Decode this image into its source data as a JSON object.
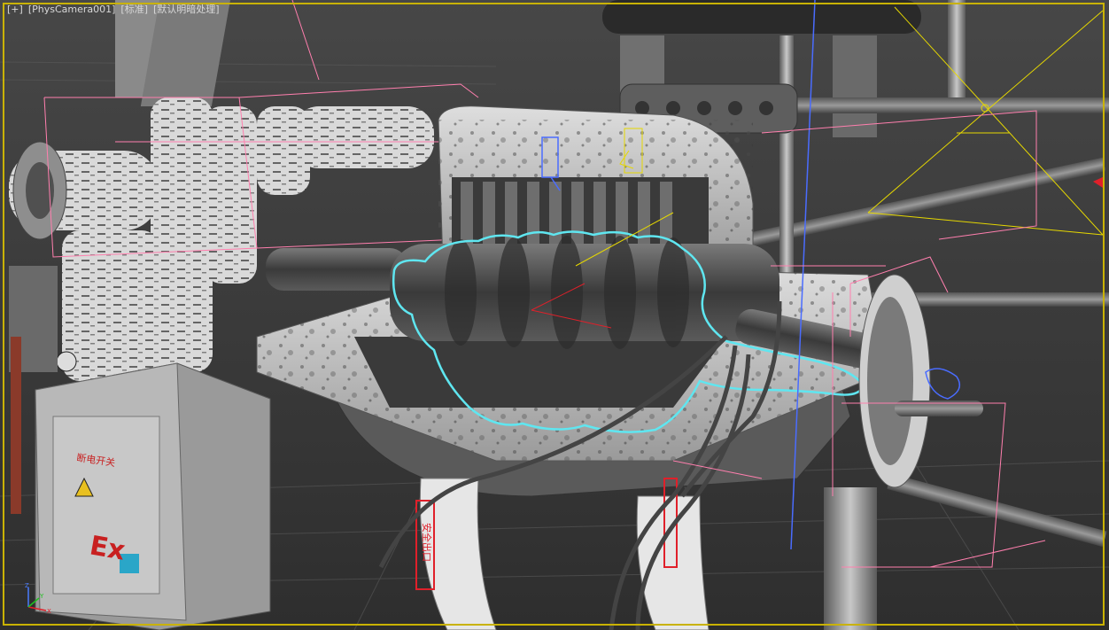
{
  "viewport": {
    "menu_plus": "[+]",
    "camera": "[PhysCamera001]",
    "shading": "[标准]",
    "lighting": "[默认明暗处理]"
  },
  "scene_labels": {
    "panel_sign": "断电开关",
    "panel_ex": "Ex",
    "pedestal_sign": "安全出口"
  },
  "gizmo": {
    "axis_y": "Y",
    "axis_x": "X",
    "axis_z": "Z"
  },
  "colors": {
    "selection_border": "#c9b200",
    "selected_object": "#5fe6f0",
    "helper_lines": "#ff7fae",
    "camera_gizmo": "#e6d800",
    "light_gizmo": "#4a6cff"
  }
}
